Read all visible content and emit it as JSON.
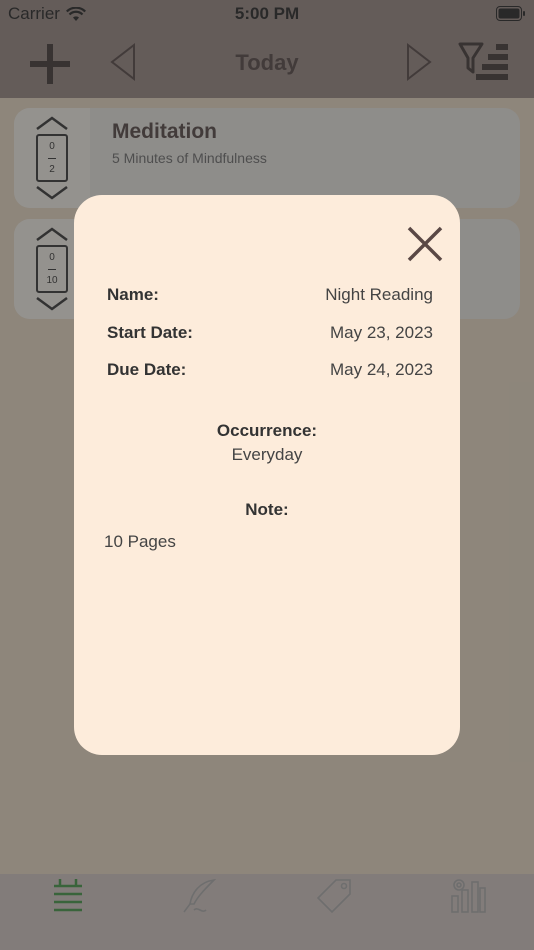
{
  "status_bar": {
    "carrier": "Carrier",
    "time": "5:00 PM"
  },
  "nav": {
    "title": "Today"
  },
  "habits": [
    {
      "title": "Meditation",
      "subtitle": "5 Minutes of Mindfulness",
      "count": "0",
      "goal": "2"
    },
    {
      "title": "",
      "subtitle": "",
      "count": "0",
      "goal": "10"
    }
  ],
  "modal": {
    "name_label": "Name:",
    "name_value": "Night Reading",
    "start_label": "Start Date:",
    "start_value": "May 23, 2023",
    "due_label": "Due Date:",
    "due_value": "May 24, 2023",
    "occurrence_label": "Occurrence:",
    "occurrence_value": "Everyday",
    "note_label": "Note:",
    "note_value": "10 Pages"
  },
  "tabs": [
    {
      "icon": "habit-list-icon",
      "active": true
    },
    {
      "icon": "quill-icon",
      "active": false
    },
    {
      "icon": "tag-icon",
      "active": false
    },
    {
      "icon": "stats-settings-icon",
      "active": false
    }
  ],
  "colors": {
    "accent": "#2e7d32",
    "modal_bg": "#fdecdb",
    "nav_bg": "#7d6d69"
  }
}
